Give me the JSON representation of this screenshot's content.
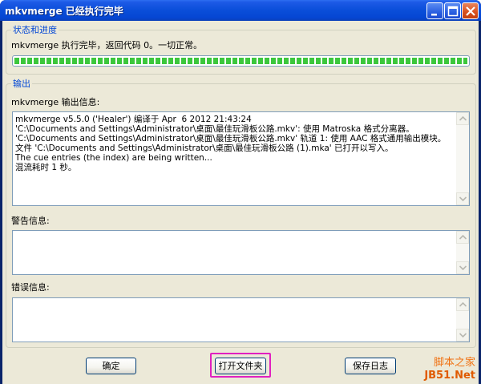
{
  "window": {
    "title": "mkvmerge 已经执行完毕",
    "controls": {
      "minimize": "minimize-icon",
      "maximize": "maximize-icon",
      "close": "close-icon"
    }
  },
  "status_group": {
    "legend": "状态和进度",
    "status_text": "mkvmerge 执行完毕，返回代码 0。一切正常。",
    "progress_percent": 100,
    "progress_color": "#3cc73c"
  },
  "output_group": {
    "legend": "输出",
    "output_label": "mkvmerge 输出信息:",
    "output_lines": "mkvmerge v5.5.0 ('Healer') 编译于 Apr  6 2012 21:43:24\n'C:\\Documents and Settings\\Administrator\\桌面\\最佳玩滑板公路.mkv': 使用 Matroska 格式分离器。\n'C:\\Documents and Settings\\Administrator\\桌面\\最佳玩滑板公路.mkv' 轨道 1: 使用 AAC 格式通用输出模块。\n文件 'C:\\Documents and Settings\\Administrator\\桌面\\最佳玩滑板公路 (1).mka' 已打开以写入。\nThe cue entries (the index) are being written...\n混流耗时 1 秒。",
    "warning_label": "警告信息:",
    "warning_text": "",
    "error_label": "错误信息:",
    "error_text": ""
  },
  "buttons": {
    "ok": "确定",
    "open_folder": "打开文件夹",
    "save_log": "保存日志"
  },
  "watermark": {
    "line1": "脚本之家",
    "line2": "JB51.Net"
  }
}
